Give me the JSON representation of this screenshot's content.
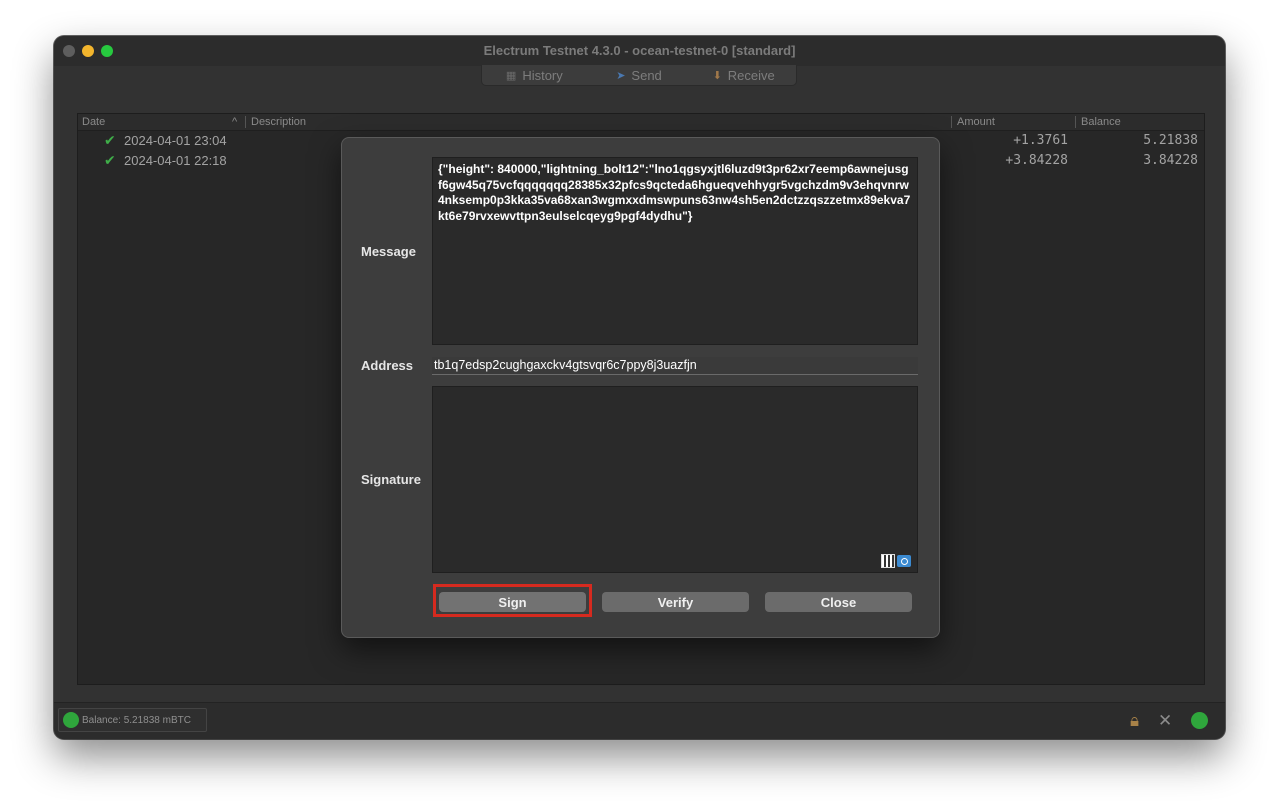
{
  "window": {
    "title": "Electrum Testnet 4.3.0  -  ocean-testnet-0  [standard]"
  },
  "tabs": [
    {
      "label": "History",
      "icon": "history-icon"
    },
    {
      "label": "Send",
      "icon": "send-icon"
    },
    {
      "label": "Receive",
      "icon": "receive-icon"
    }
  ],
  "history": {
    "columns": {
      "date": "Date",
      "sort_indicator": "^",
      "description": "Description",
      "amount": "Amount",
      "balance": "Balance"
    },
    "rows": [
      {
        "status_icon": "check-icon",
        "date": "2024-04-01 23:04",
        "amount": "+1.3761",
        "balance": "5.21838"
      },
      {
        "status_icon": "check-icon",
        "date": "2024-04-01 22:18",
        "amount": "+3.84228",
        "balance": "3.84228"
      }
    ]
  },
  "dialog": {
    "message_label": "Message",
    "message_value": "{\"height\": 840000,\"lightning_bolt12\":\"lno1qgsyxjtl6luzd9t3pr62xr7eemp6awnejusgf6gw45q75vcfqqqqqqq28385x32pfcs9qcteda6hgueqvehhygr5vgchzdm9v3ehqvnrw4nksemp0p3kka35va68xan3wgmxxdmswpuns63nw4sh5en2dctzzqszzetmx89ekva7kt6e79rvxewvttpn3eulselcqeyg9pgf4dydhu\"}",
    "address_label": "Address",
    "address_value": "tb1q7edsp2cughgaxckv4gtsvqr6c7ppy8j3uazfjn",
    "signature_label": "Signature",
    "signature_value": "",
    "buttons": {
      "sign": "Sign",
      "verify": "Verify",
      "close": "Close"
    }
  },
  "statusbar": {
    "balance": "Balance: 5.21838 mBTC"
  },
  "colors": {
    "highlight": "#d62a1f",
    "status_green": "#2fa63c"
  }
}
